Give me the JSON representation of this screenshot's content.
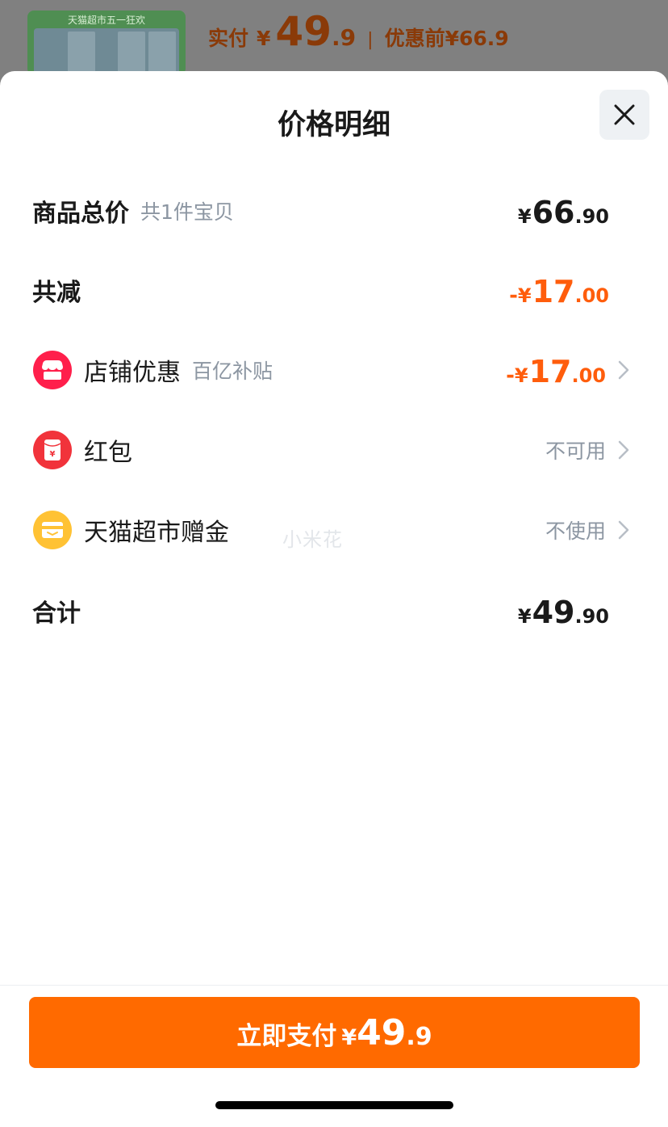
{
  "background": {
    "thumb_caption": "天猫超市五一狂欢",
    "pay_label": "实付",
    "currency": "¥",
    "pay_int": "49",
    "pay_dec": ".9",
    "separator": "|",
    "before_label": "优惠前",
    "before_price": "¥66.9"
  },
  "sheet": {
    "title": "价格明细",
    "close_icon": "close-icon"
  },
  "rows": {
    "goods": {
      "label": "商品总价",
      "sub": "共1件宝贝",
      "currency": "¥",
      "int": "66",
      "dec": ".90"
    },
    "total_discount": {
      "label": "共减",
      "sign": "-",
      "currency": "¥",
      "int": "17",
      "dec": ".00"
    },
    "store_discount": {
      "label": "店铺优惠",
      "sub": "百亿补贴",
      "sign": "-",
      "currency": "¥",
      "int": "17",
      "dec": ".00",
      "icon": "store-icon"
    },
    "red_packet": {
      "label": "红包",
      "status": "不可用",
      "icon": "red-packet-icon"
    },
    "tmall_bonus": {
      "label": "天猫超市赠金",
      "status": "不使用",
      "icon": "wallet-icon"
    },
    "sum": {
      "label": "合计",
      "currency": "¥",
      "int": "49",
      "dec": ".90"
    }
  },
  "watermark": "小米花",
  "pay_button": {
    "label": "立即支付",
    "currency": "¥",
    "int": "49",
    "dec": ".9"
  },
  "colors": {
    "accent": "#ff6a00",
    "discount": "#ff5d0c",
    "store_icon": "#ff1f4b",
    "red_packet_icon": "#f1333b",
    "bonus_icon": "#ffc234",
    "muted_text": "#8c96a2"
  }
}
